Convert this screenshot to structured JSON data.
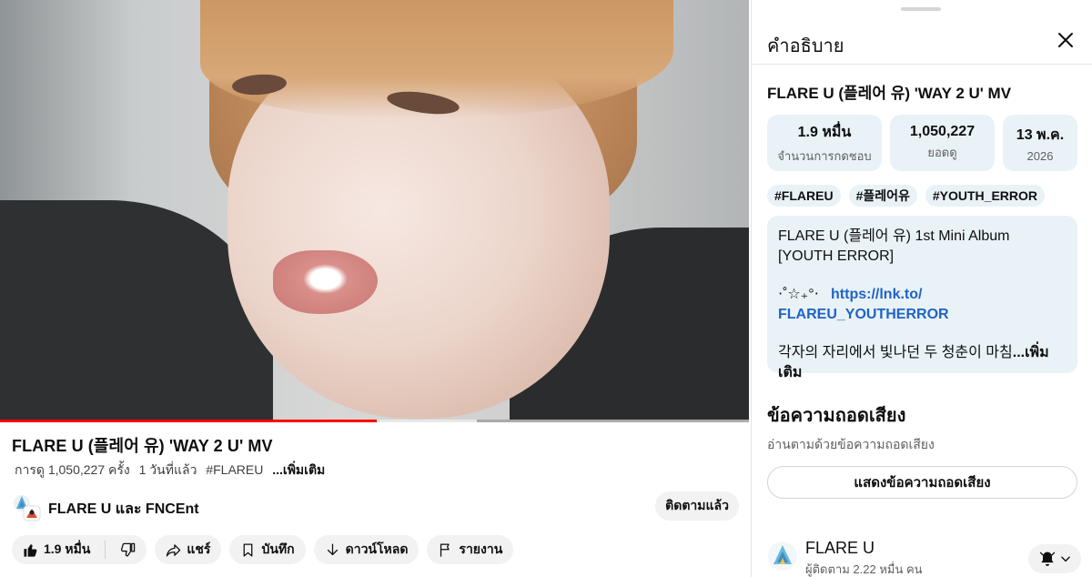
{
  "video": {
    "progress_played": 0.503,
    "progress_buffered": 0.637,
    "title": "FLARE U (플레어 유) 'WAY 2 U' MV",
    "views": "การดู 1,050,227 ครั้ง",
    "age": "1 วันที่แล้ว",
    "hashtag": "#FLAREU",
    "more": "...เพิ่มเติม"
  },
  "channel": {
    "name": "FLARE U และ FNCEnt",
    "subscribe_label": "ติดตามแล้ว"
  },
  "actions": {
    "like_count": "1.9 หมื่น",
    "share": "แชร์",
    "save": "บันทึก",
    "download": "ดาวน์โหลด",
    "report": "รายงาน"
  },
  "panel": {
    "header": "คำอธิบาย",
    "title": "FLARE U (플레어 유) 'WAY 2 U' MV",
    "stats": [
      {
        "value": "1.9 หมื่น",
        "label": "จำนวนการกดชอบ"
      },
      {
        "value": "1,050,227",
        "label": "ยอดดู"
      },
      {
        "value": "13 พ.ค.",
        "label": "2026"
      }
    ],
    "tags": [
      "#FLAREU",
      "#플레어유",
      "#YOUTH_ERROR"
    ],
    "description": {
      "line1": "FLARE U (플레어 유) 1st Mini Album",
      "line2": "[YOUTH ERROR]",
      "deco": "⋅˚☆₊°⋅",
      "link1": "https://lnk.to/",
      "link2": "FLAREU_YOUTHERROR",
      "line3": "각자의 자리에서 빛나던 두 청춘이 마침",
      "more": "...เพิ่มเติม"
    },
    "transcript": {
      "heading": "ข้อความถอดเสียง",
      "sub": "อ่านตามด้วยข้อความถอดเสียง",
      "button": "แสดงข้อความถอดเสียง"
    },
    "channel": {
      "name": "FLARE U",
      "subs": "ผู้ติดตาม 2.22 หมื่น คน"
    }
  },
  "colors": {
    "progress_played": "#ff0000",
    "link": "#1f63c6",
    "chip_bg": "#e9f2f7",
    "button_bg": "#f2f2f2"
  }
}
